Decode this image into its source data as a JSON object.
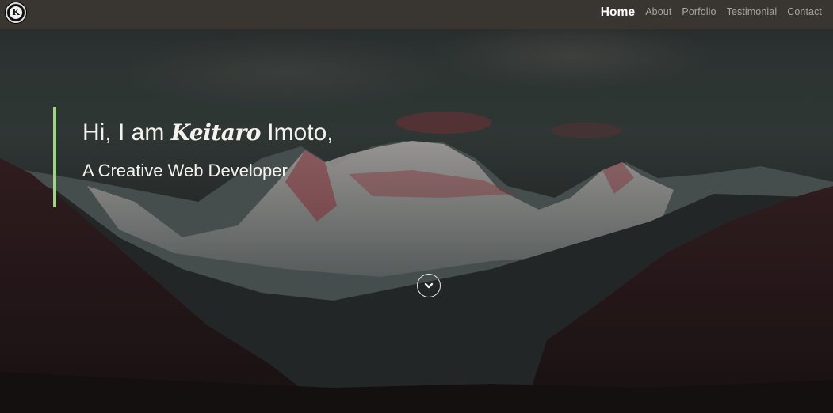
{
  "brand": {
    "logo_letter": "K",
    "icon": "k-logo-icon"
  },
  "nav": {
    "items": [
      {
        "label": "Home",
        "active": true
      },
      {
        "label": "About",
        "active": false
      },
      {
        "label": "Porfolio",
        "active": false
      },
      {
        "label": "Testimonial",
        "active": false
      },
      {
        "label": "Contact",
        "active": false
      }
    ]
  },
  "hero": {
    "greeting_prefix": "Hi, I am",
    "first_name": "Keitaro",
    "last_name": "Imoto,",
    "tagline": "A Creative Web Developer",
    "scroll_icon": "chevron-down-icon"
  },
  "colors": {
    "accent": "#9fd485",
    "navbar_bg": "#3a3732",
    "nav_text": "#a7a49c",
    "nav_active": "#ffffff",
    "hero_text": "#f4f2ee"
  }
}
